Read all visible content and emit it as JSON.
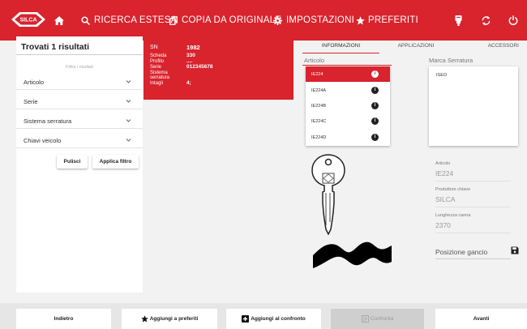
{
  "topbar": {
    "brand": "SILCA",
    "ricerca_label": "RICERCA ESTESA",
    "copia_label": "COPIA DA ORIGINALE",
    "impostazioni_label": "IMPOSTAZIONI",
    "preferiti_label": "PREFERITI",
    "bg_color": "#d9232d"
  },
  "left": {
    "results_title": "Trovati 1 risultati",
    "filter_heading": "Filtra i risultati",
    "filters": [
      {
        "label": "Articolo"
      },
      {
        "label": "Serie"
      },
      {
        "label": "Sistema serratura"
      },
      {
        "label": "Chiavi veicolo"
      }
    ],
    "clear_label": "Pulisci",
    "apply_label": "Applica filtro"
  },
  "card": {
    "rows": [
      {
        "key": "SN",
        "value": "1982"
      },
      {
        "key": "Scheda",
        "value": "330"
      },
      {
        "key": "Profilo",
        "value": "...."
      },
      {
        "key": "Serie",
        "value": "012345678"
      },
      {
        "key": "Sistema serratura",
        "value": ""
      },
      {
        "key": "Intagli",
        "value": "4;"
      }
    ]
  },
  "tabs": [
    {
      "label": "INFORMAZIONI",
      "active": true
    },
    {
      "label": "APPLICAZIONI",
      "active": false
    },
    {
      "label": "ACCESSORI",
      "active": false
    }
  ],
  "info": {
    "articolo_label": "Articolo",
    "marca_label": "Marca Serratura",
    "articles": [
      "IE224",
      "IE224A",
      "IE224B",
      "IE224C",
      "IE224D"
    ],
    "selected_article": "IE224",
    "marca_value": "ISEO",
    "fields": [
      {
        "label": "Articolo",
        "value": "IE224"
      },
      {
        "label": "Produttore chiave",
        "value": "SILCA"
      },
      {
        "label": "Lunghezza canna",
        "value": "2370"
      }
    ],
    "posizione_label": "Posizione gancio"
  },
  "bottom": {
    "indietro_label": "Indietro",
    "preferiti_label": "Aggiungi a preferiti",
    "confronto_label": "Aggiungi al confronto",
    "confronta_label": "Confronta",
    "avanti_label": "Avanti"
  }
}
